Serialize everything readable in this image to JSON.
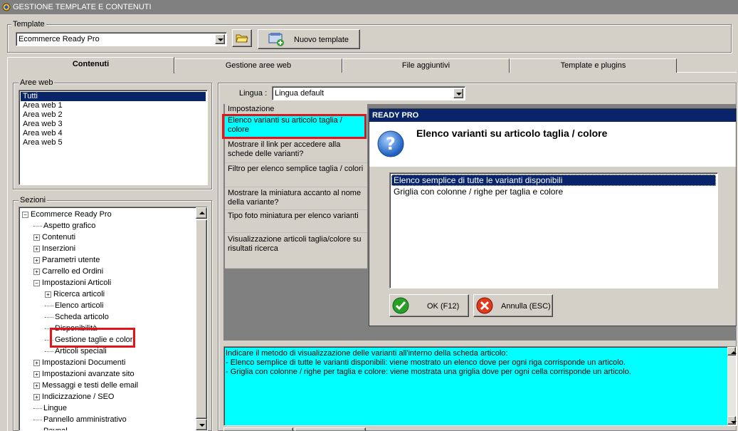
{
  "window": {
    "title": "GESTIONE TEMPLATE E CONTENUTI"
  },
  "template_group": {
    "label": "Template",
    "selected": "Ecommerce Ready Pro",
    "new_button": "Nuovo template"
  },
  "tabs": [
    {
      "label": "Contenuti",
      "active": true
    },
    {
      "label": "Gestione aree web",
      "active": false
    },
    {
      "label": "File aggiuntivi",
      "active": false
    },
    {
      "label": "Template e plugins",
      "active": false
    }
  ],
  "aree_web": {
    "label": "Aree web",
    "items": [
      "Tutti",
      "Area web 1",
      "Area web 2",
      "Area web 3",
      "Area web 4",
      "Area web 5"
    ],
    "selected_index": 0
  },
  "sezioni": {
    "label": "Sezioni",
    "items": [
      {
        "label": "Ecommerce Ready Pro",
        "level": 0,
        "expander": "minus"
      },
      {
        "label": "Aspetto grafico",
        "level": 1,
        "expander": "none"
      },
      {
        "label": "Contenuti",
        "level": 1,
        "expander": "plus"
      },
      {
        "label": "Inserzioni",
        "level": 1,
        "expander": "plus"
      },
      {
        "label": "Parametri utente",
        "level": 1,
        "expander": "plus"
      },
      {
        "label": "Carrello ed Ordini",
        "level": 1,
        "expander": "plus"
      },
      {
        "label": "Impostazioni Articoli",
        "level": 1,
        "expander": "minus"
      },
      {
        "label": "Ricerca articoli",
        "level": 2,
        "expander": "plus"
      },
      {
        "label": "Elenco articoli",
        "level": 2,
        "expander": "none"
      },
      {
        "label": "Scheda articolo",
        "level": 2,
        "expander": "none"
      },
      {
        "label": "Disponibilità",
        "level": 2,
        "expander": "none"
      },
      {
        "label": "Gestione taglie e colori",
        "level": 2,
        "expander": "none",
        "highlighted": true
      },
      {
        "label": "Articoli speciali",
        "level": 2,
        "expander": "none"
      },
      {
        "label": "Impostazioni Documenti",
        "level": 1,
        "expander": "plus"
      },
      {
        "label": "Impostazioni avanzate sito",
        "level": 1,
        "expander": "plus"
      },
      {
        "label": "Messaggi e testi delle email",
        "level": 1,
        "expander": "plus"
      },
      {
        "label": "Indicizzazione / SEO",
        "level": 1,
        "expander": "plus"
      },
      {
        "label": "Lingue",
        "level": 1,
        "expander": "none"
      },
      {
        "label": "Pannello amministrativo",
        "level": 1,
        "expander": "none"
      },
      {
        "label": "Paypal",
        "level": 1,
        "expander": "none"
      }
    ]
  },
  "lingua": {
    "label": "Lingua :",
    "selected": "Lingua default"
  },
  "settings_grid": {
    "header": "Impostazione",
    "rows": [
      "Elenco varianti su articolo taglia / colore",
      "Mostrare il link per accedere alla schede delle varianti?",
      "Filtro per elenco semplice taglia / colori",
      "Mostrare la miniatura accanto al nome della variante?",
      "Tipo foto miniatura per elenco varianti",
      "Visualizzazione articoli taglia/colore su risultati ricerca"
    ]
  },
  "dialog": {
    "title": "READY PRO",
    "heading": "Elenco varianti su articolo taglia / colore",
    "options": [
      "Elenco semplice di tutte le varianti disponibili",
      "Griglia con colonne / righe per taglia e colore"
    ],
    "selected_index": 0,
    "ok_label": "OK (F12)",
    "cancel_label": "Annulla (ESC)"
  },
  "description": {
    "lines": [
      "Indicare il metodo di visualizzazione delle varianti all'interno della scheda articolo:",
      "- Elenco semplice di tutte le varianti disponibili: viene mostrato un elenco dove per ogni riga corrisponde un articolo.",
      "- Griglia con colonne / righe per taglia e colore: viene mostrata una griglia dove per ogni cella corrisponde un articolo."
    ]
  },
  "colors": {
    "highlight": "#00ffff",
    "selection": "#0a246a",
    "callout": "#e0161c",
    "dialog_title": "#0a246a"
  }
}
